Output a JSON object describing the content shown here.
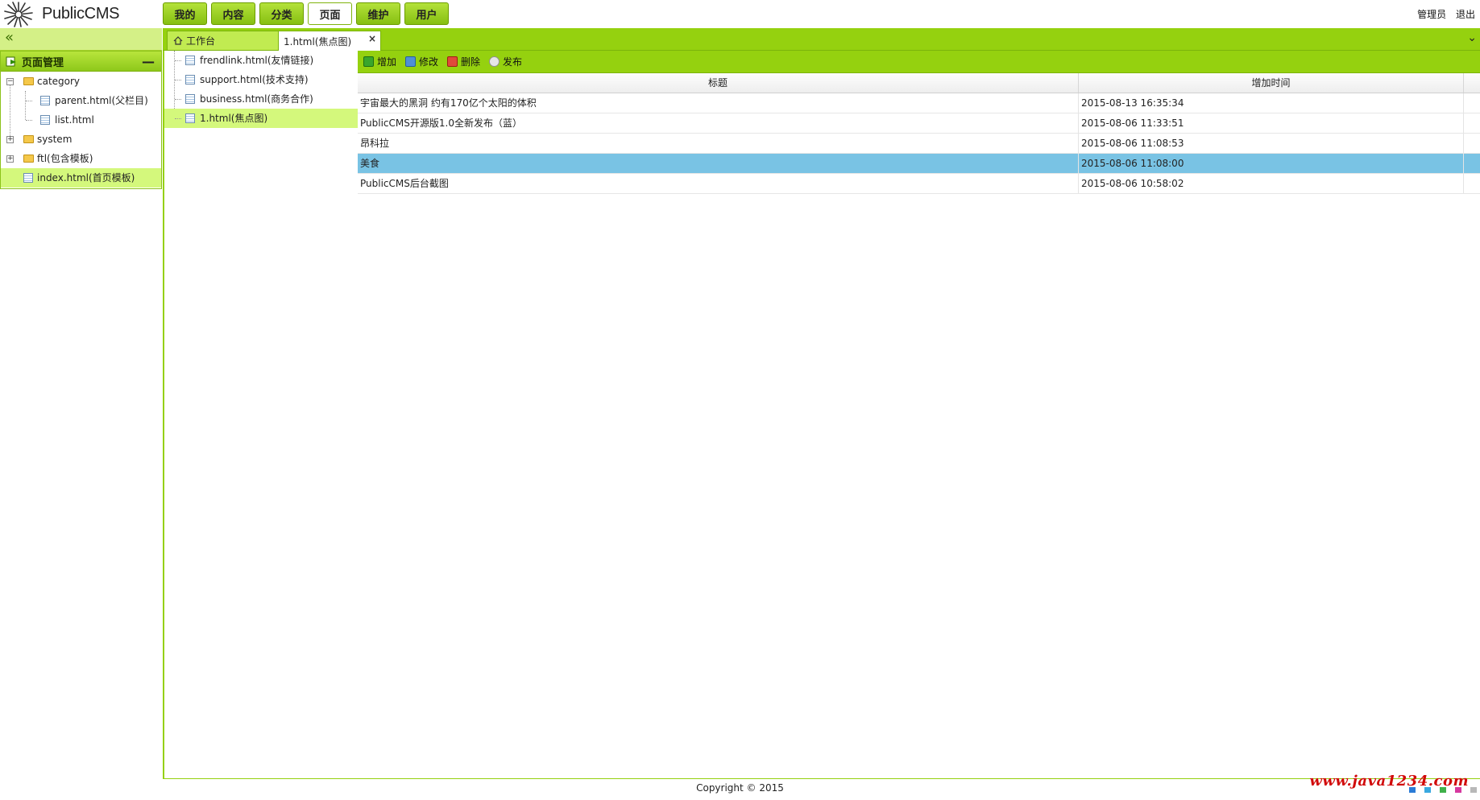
{
  "app": {
    "logo_text": "PublicCMS"
  },
  "main_menu": [
    {
      "label": "我的",
      "active": false
    },
    {
      "label": "内容",
      "active": false
    },
    {
      "label": "分类",
      "active": false
    },
    {
      "label": "页面",
      "active": true
    },
    {
      "label": "维护",
      "active": false
    },
    {
      "label": "用户",
      "active": false
    }
  ],
  "user_area": {
    "username": "管理员",
    "logout": "退出"
  },
  "left_panel": {
    "title": "页面管理",
    "tree": [
      {
        "label": "category",
        "type": "folder",
        "expanded": true
      },
      {
        "label": "parent.html(父栏目)",
        "type": "file"
      },
      {
        "label": "list.html",
        "type": "file"
      },
      {
        "label": "system",
        "type": "folder",
        "expanded": false
      },
      {
        "label": "ftl(包含模板)",
        "type": "folder",
        "expanded": false
      },
      {
        "label": "index.html(首页模板)",
        "type": "file",
        "selected": true
      }
    ]
  },
  "tabs": [
    {
      "label": "工作台",
      "icon": "home-icon"
    },
    {
      "label": "1.html(焦点图)",
      "active": true,
      "close": "×"
    }
  ],
  "page_tree": [
    {
      "label": "frendlink.html(友情链接)"
    },
    {
      "label": "support.html(技术支持)"
    },
    {
      "label": "business.html(商务合作)"
    },
    {
      "label": "1.html(焦点图)",
      "selected": true
    }
  ],
  "toolbar": {
    "add": "增加",
    "edit": "修改",
    "delete": "删除",
    "publish": "发布"
  },
  "grid": {
    "columns": [
      "标题",
      "增加时间"
    ],
    "rows": [
      {
        "title": "宇宙最大的黑洞 约有170亿个太阳的体积",
        "time": "2015-08-13 16:35:34"
      },
      {
        "title": "PublicCMS开源版1.0全新发布（蓝）",
        "time": "2015-08-06 11:33:51"
      },
      {
        "title": "昂科拉",
        "time": "2015-08-06 11:08:53"
      },
      {
        "title": "美食",
        "time": "2015-08-06 11:08:00",
        "selected": true
      },
      {
        "title": "PublicCMS后台截图",
        "time": "2015-08-06 10:58:02"
      }
    ]
  },
  "footer": {
    "copyright": "Copyright © 2015"
  },
  "watermark": {
    "text": "www.java1234.com"
  },
  "colors": {
    "accent": "#95d10f",
    "selected_row": "#79c3e4",
    "tree_selected": "#d4f87c",
    "watermark": "#d10a0a"
  }
}
